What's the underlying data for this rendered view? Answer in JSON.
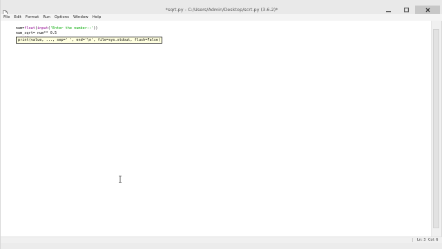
{
  "window": {
    "title": "*sqrt.py - C:/Users/Admin/Desktop/scrt.py (3.6.2)*",
    "controls": {
      "minimize_icon": "minimize-icon",
      "maximize_icon": "maximize-icon",
      "close_icon": "close-icon"
    }
  },
  "menu": {
    "items": [
      "File",
      "Edit",
      "Format",
      "Run",
      "Options",
      "Window",
      "Help"
    ]
  },
  "editor": {
    "lines": [
      {
        "segments": [
          {
            "text": "num=",
            "kind": "plain"
          },
          {
            "text": "float",
            "kind": "builtin"
          },
          {
            "text": "(",
            "kind": "plain"
          },
          {
            "text": "input",
            "kind": "builtin"
          },
          {
            "text": "(",
            "kind": "plain"
          },
          {
            "text": "'Enter the number::'",
            "kind": "string"
          },
          {
            "text": "))",
            "kind": "plain"
          }
        ]
      },
      {
        "segments": [
          {
            "text": "num_sqrt= num** 0.5",
            "kind": "plain"
          }
        ]
      },
      {
        "segments": [
          {
            "text": "print",
            "kind": "builtin"
          },
          {
            "text": "(",
            "kind": "plain"
          }
        ]
      }
    ],
    "calltip": "print(value, ..., sep=' ', end='\\n', file=sys.stdout, flush=False)"
  },
  "status": {
    "line": "Ln: 3",
    "col": "Col: 6"
  },
  "colors": {
    "builtin": "#900090",
    "string": "#00aa00",
    "calltip_bg": "#ffffe0"
  }
}
